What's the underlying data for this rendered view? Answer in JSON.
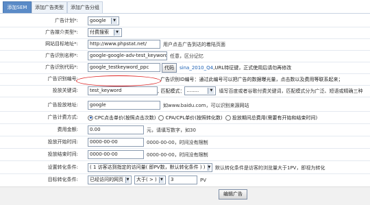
{
  "tabs": [
    "添加SEM",
    "添加广告类型",
    "添加广告分组"
  ],
  "rows": {
    "plan": {
      "label": "广告计划*:",
      "value": "google"
    },
    "media": {
      "label": "广告媒介类型*:",
      "value": "付费搜索"
    },
    "url": {
      "label": "网站目标地址*:",
      "value": "http://www.phpstat.net/",
      "note": "用户点击广告到达的着陆页面"
    },
    "name": {
      "label": "广告识别名称*:",
      "value": "google-google-adv-test_keyword",
      "note": "任意，区分记忆"
    },
    "code": {
      "label": "广告识别代码*:",
      "value": "google_testkeyword_ppc",
      "btn": "代码",
      "link": "sina_2010_Q4",
      "note": ",URL特征键，正式使用后请勿再修改"
    },
    "id": {
      "label": "广告识别编号:",
      "note": "广告识别ID编号：通过此编号可以把广告的数据曝光量，点击数以及费用等联系起来；"
    },
    "keyword": {
      "label": "投放关键词:",
      "value": "test_keyword",
      "match_label": ", 匹配模式：",
      "match_value": "........",
      "note": "填写百度或者谷歌付费关键词，匹配模式分为广泛、短语或精确三种"
    },
    "address": {
      "label": "广告投放地址:",
      "value": "google",
      "note": "如www.baidu.com，可以识别来源网站"
    },
    "billing": {
      "label": "广告计费方式:",
      "options": [
        "CPC点击单价(按照点击次数)",
        "CPA/CPL单价(按照转化数)",
        "投放期间总费用(需要有开始和结束时间)"
      ]
    },
    "cost": {
      "label": "费用金额:",
      "value": "0.00",
      "note": "元，请填写数字，如30"
    },
    "start": {
      "label": "投放开始时间:",
      "value": "0000-00-00",
      "note": "0000-00-00，时间没有限制"
    },
    "end": {
      "label": "投放结束时间:",
      "value": "0000-00-00",
      "note": "0000-00-00，时间没有限制"
    },
    "conversion": {
      "label": "设置转化条件:",
      "value": "( 1 访客达到指定的访问量( 即PV数，默认转化条件 ) )",
      "note": "默认转化条件是访客的浏览量大于1PV，即视为转化"
    },
    "target": {
      "label": "目标转化条件:",
      "page": "已经访问的网页",
      "op": "大于( > )",
      "num": "3",
      "unit": "PV"
    }
  },
  "submit": "编辑广告"
}
